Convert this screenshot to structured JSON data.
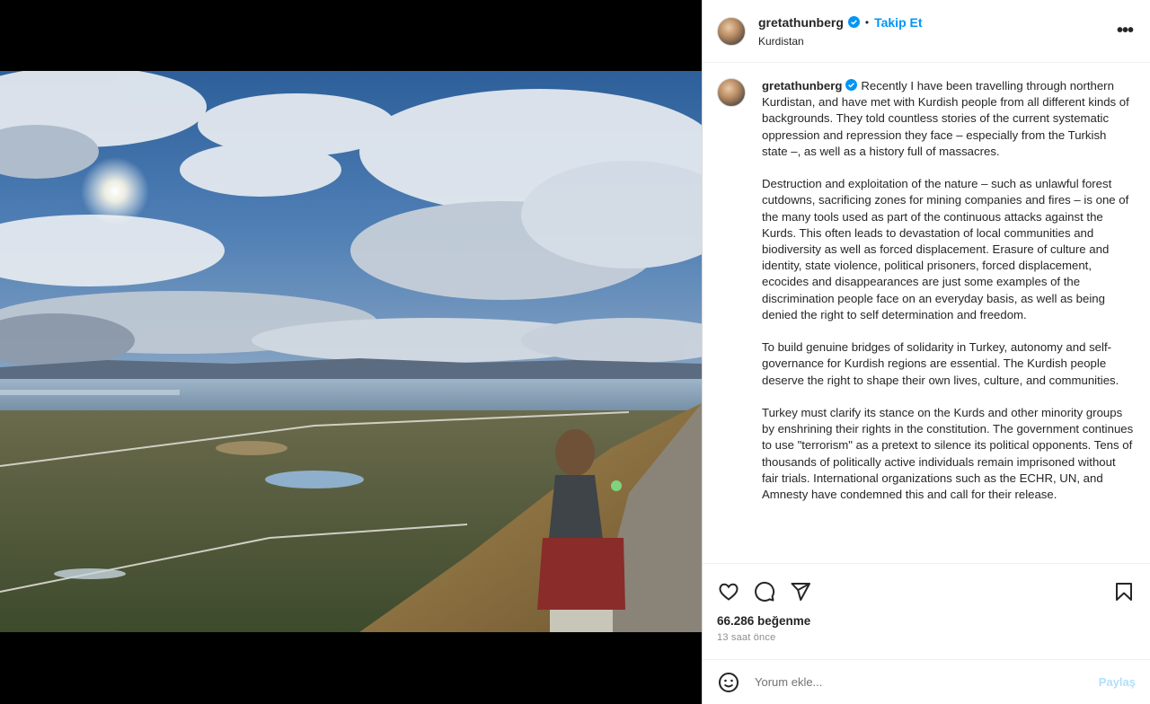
{
  "post": {
    "username": "gretathunberg",
    "verified": true,
    "follow_label": "Takip Et",
    "location": "Kurdistan",
    "more_label": "•••"
  },
  "caption": {
    "username": "gretathunberg",
    "paragraphs": [
      "Recently I have been travelling through northern Kurdistan, and have met with Kurdish people from all different kinds of backgrounds. They told countless stories of the current systematic oppression and repression they face – especially from the Turkish state –, as well as a history full of massacres.",
      "Destruction and exploitation of the nature – such as unlawful forest cutdowns, sacrificing zones for mining companies and fires – is one of the many tools used as part of the continuous attacks against the Kurds. This often leads to devastation of local communities and biodiversity as well as forced displacement. Erasure of culture and identity, state violence, political prisoners, forced displacement, ecocides and disappearances are just some examples of the discrimination people face on an everyday basis, as well as being denied the right to self determination and freedom.",
      "To build genuine bridges of solidarity in Turkey, autonomy and self-governance for Kurdish regions are essential. The Kurdish people deserve the right to shape their own lives, culture, and communities.",
      "Turkey must clarify its stance on the Kurds and other minority groups by enshrining their rights in the constitution. The government continues to use \"terrorism\" as a pretext to silence its political opponents. Tens of thousands of politically active individuals remain imprisoned without fair trials. International organizations such as the ECHR, UN, and Amnesty have condemned this and call for their release."
    ]
  },
  "stats": {
    "likes": "66.286 beğenme",
    "time": "13 saat önce"
  },
  "comment": {
    "placeholder": "Yorum ekle...",
    "post_label": "Paylaş"
  },
  "icons": {
    "like": "heart-icon",
    "comment": "comment-icon",
    "share": "share-icon",
    "save": "bookmark-icon",
    "emoji": "emoji-icon",
    "verified": "verified-badge-icon"
  },
  "colors": {
    "accent": "#0095f6",
    "post_disabled": "#b2dffc",
    "text": "#262626",
    "muted": "#8e8e8e"
  }
}
